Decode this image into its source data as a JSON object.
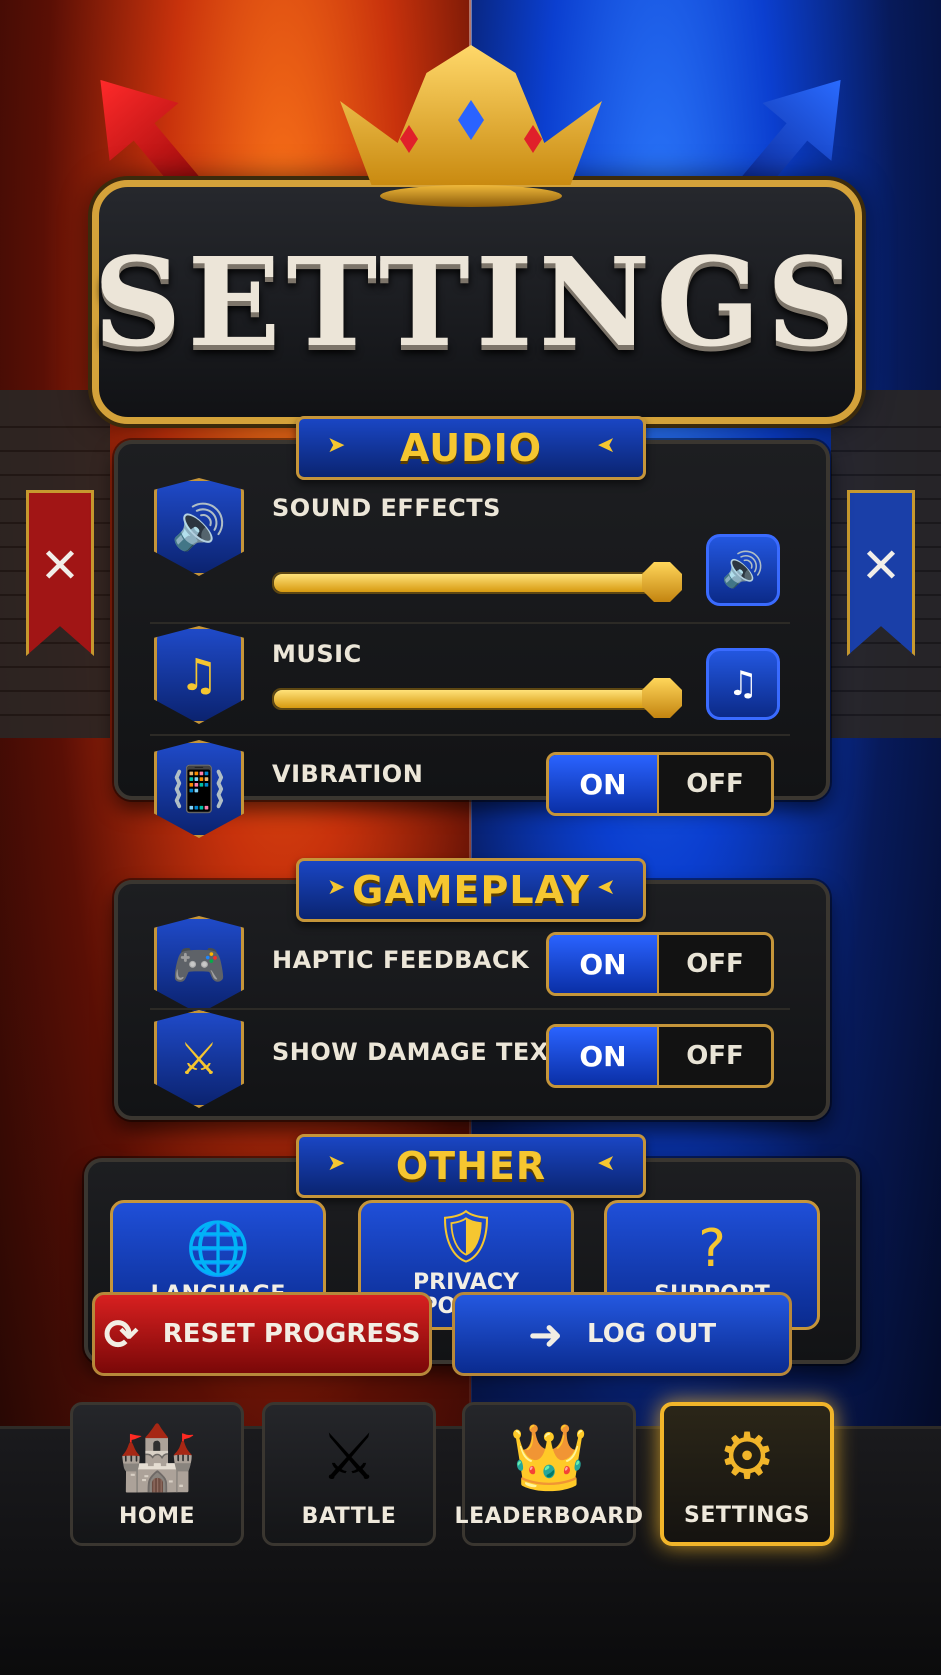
{
  "header": {
    "title": "SETTINGS"
  },
  "sections": {
    "audio": {
      "title": "AUDIO",
      "sound_effects": {
        "label": "SOUND EFFECTS",
        "level": 0.97
      },
      "music": {
        "label": "MUSIC",
        "level": 0.97
      },
      "vibration": {
        "label": "VIBRATION",
        "on": "ON",
        "off": "OFF",
        "selected": "ON"
      }
    },
    "gameplay": {
      "title": "GAMEPLAY",
      "haptic": {
        "label": "HAPTIC FEEDBACK",
        "on": "ON",
        "off": "OFF",
        "selected": "ON"
      },
      "damage": {
        "label": "SHOW DAMAGE TEXT",
        "on": "ON",
        "off": "OFF",
        "selected": "ON"
      }
    },
    "other": {
      "title": "OTHER",
      "language": "LANGUAGE",
      "privacy": "PRIVACY POLICY",
      "support": "SUPPORT"
    }
  },
  "actions": {
    "reset": "RESET PROGRESS",
    "logout": "LOG OUT"
  },
  "nav": {
    "home": "HOME",
    "battle": "BATTLE",
    "leaderboard": "LEADERBOARD",
    "settings": "SETTINGS",
    "active": "settings"
  },
  "icons": {
    "sound": "speaker-icon",
    "music": "music-note-icon",
    "vibration": "vibrating-phone-icon",
    "haptic": "gamepad-icon",
    "damage": "crossed-swords-icon",
    "language": "globe-icon",
    "privacy": "shield-icon",
    "support": "question-bubble-icon",
    "reset": "refresh-icon",
    "logout": "exit-icon"
  },
  "colors": {
    "gold": "#f5c630",
    "blue": "#1f4fd8",
    "red": "#d82020",
    "accent_on": "#2a63ff"
  }
}
